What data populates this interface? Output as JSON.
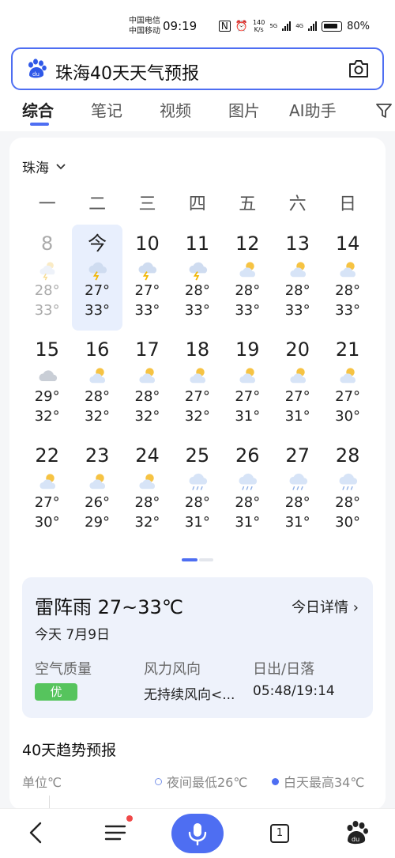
{
  "status_bar": {
    "carrier_1": "中国电信",
    "carrier_2": "中国移动",
    "time": "09:19",
    "speed_value": "140",
    "speed_unit": "K/s",
    "net_1": "5G",
    "net_2": "4G",
    "battery": "80%"
  },
  "search": {
    "query": "珠海40天天气预报"
  },
  "tabs": [
    {
      "label": "综合"
    },
    {
      "label": "笔记"
    },
    {
      "label": "视频"
    },
    {
      "label": "图片"
    },
    {
      "label": "AI助手"
    }
  ],
  "weather": {
    "city": "珠海",
    "weekdays": [
      "一",
      "二",
      "三",
      "四",
      "五",
      "六",
      "日"
    ],
    "days": [
      {
        "day": "8",
        "low": "28°",
        "high": "33°",
        "icon": "thunder-cloud-sun-icon"
      },
      {
        "day": "今",
        "low": "27°",
        "high": "33°",
        "icon": "thunderstorm-icon"
      },
      {
        "day": "10",
        "low": "27°",
        "high": "33°",
        "icon": "thunderstorm-icon"
      },
      {
        "day": "11",
        "low": "28°",
        "high": "33°",
        "icon": "thunderstorm-icon"
      },
      {
        "day": "12",
        "low": "28°",
        "high": "33°",
        "icon": "partly-cloudy-icon"
      },
      {
        "day": "13",
        "low": "28°",
        "high": "33°",
        "icon": "partly-cloudy-icon"
      },
      {
        "day": "14",
        "low": "28°",
        "high": "33°",
        "icon": "partly-cloudy-icon"
      },
      {
        "day": "15",
        "low": "29°",
        "high": "32°",
        "icon": "cloudy-icon"
      },
      {
        "day": "16",
        "low": "28°",
        "high": "32°",
        "icon": "partly-cloudy-icon"
      },
      {
        "day": "17",
        "low": "28°",
        "high": "32°",
        "icon": "partly-cloudy-icon"
      },
      {
        "day": "18",
        "low": "27°",
        "high": "32°",
        "icon": "partly-cloudy-icon"
      },
      {
        "day": "19",
        "low": "27°",
        "high": "31°",
        "icon": "partly-cloudy-icon"
      },
      {
        "day": "20",
        "low": "27°",
        "high": "31°",
        "icon": "partly-cloudy-icon"
      },
      {
        "day": "21",
        "low": "27°",
        "high": "30°",
        "icon": "partly-cloudy-icon"
      },
      {
        "day": "22",
        "low": "27°",
        "high": "30°",
        "icon": "partly-cloudy-icon"
      },
      {
        "day": "23",
        "low": "26°",
        "high": "29°",
        "icon": "partly-cloudy-icon"
      },
      {
        "day": "24",
        "low": "28°",
        "high": "32°",
        "icon": "partly-cloudy-icon"
      },
      {
        "day": "25",
        "low": "28°",
        "high": "31°",
        "icon": "rain-cloud-icon"
      },
      {
        "day": "26",
        "low": "28°",
        "high": "31°",
        "icon": "rain-cloud-icon"
      },
      {
        "day": "27",
        "low": "28°",
        "high": "31°",
        "icon": "rain-cloud-icon"
      },
      {
        "day": "28",
        "low": "28°",
        "high": "30°",
        "icon": "rain-cloud-icon"
      }
    ],
    "today": {
      "headline": "雷阵雨 27~33℃",
      "detail_link": "今日详情",
      "date": "今天 7月9日",
      "aqi_label": "空气质量",
      "aqi_value": "优",
      "wind_label": "风力风向",
      "wind_value": "无持续风向<...",
      "sun_label": "日出/日落",
      "sun_value": "05:48/19:14"
    },
    "trend": {
      "title": "40天趋势预报",
      "unit": "单位℃",
      "low_legend": "夜间最低26℃",
      "high_legend": "白天最高34℃"
    }
  },
  "bottom_bar": {
    "tab_count": "1"
  },
  "colors": {
    "accent": "#4e6ef2",
    "aqi_good": "#56c45d",
    "today_bg": "#e8effd",
    "detail_bg": "#eef2fb"
  }
}
